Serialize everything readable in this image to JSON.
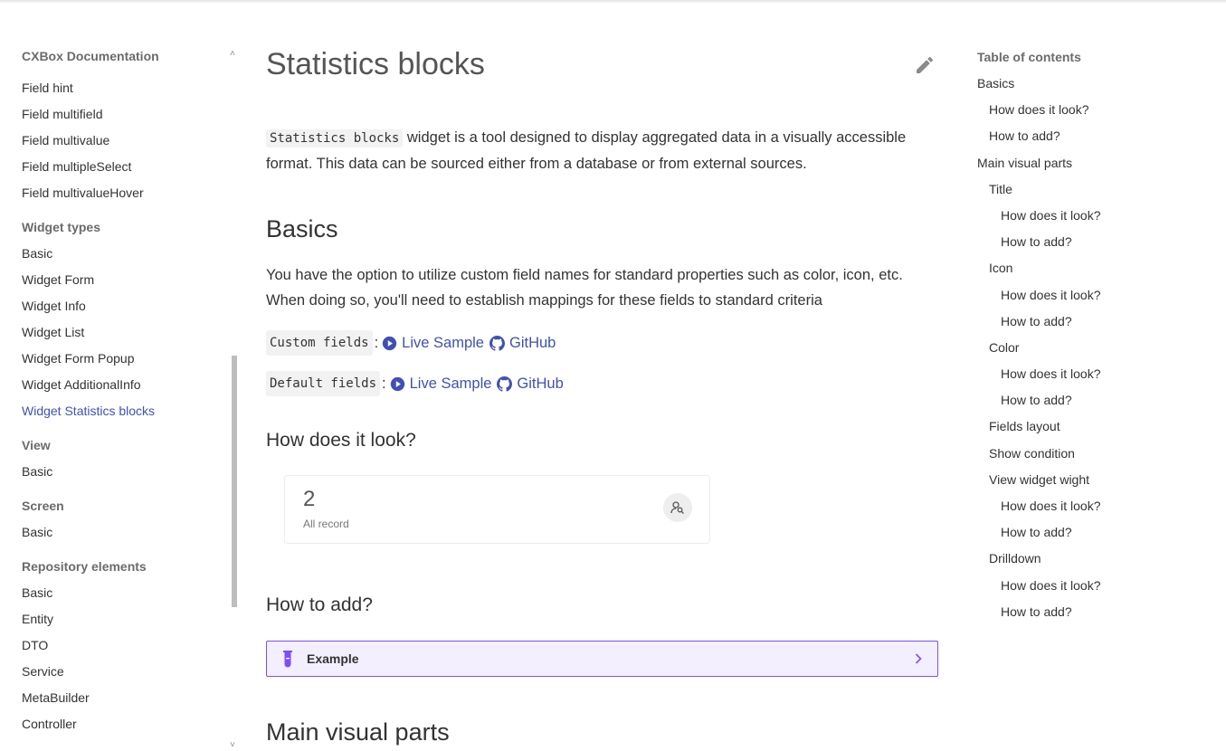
{
  "sidebar": {
    "title": "CXBox Documentation",
    "groups": [
      {
        "heading": "",
        "items": [
          "Field hint",
          "Field multifield",
          "Field multivalue",
          "Field multipleSelect",
          "Field multivalueHover"
        ]
      },
      {
        "heading": "Widget types",
        "items": [
          "Basic",
          "Widget Form",
          "Widget Info",
          "Widget List",
          "Widget Form Popup",
          "Widget AdditionalInfo",
          "Widget Statistics blocks"
        ]
      },
      {
        "heading": "View",
        "items": [
          "Basic"
        ]
      },
      {
        "heading": "Screen",
        "items": [
          "Basic"
        ]
      },
      {
        "heading": "Repository elements",
        "items": [
          "Basic",
          "Entity",
          "DTO",
          "Service",
          "MetaBuilder",
          "Controller"
        ]
      }
    ],
    "active_item": "Widget Statistics blocks"
  },
  "main": {
    "title": "Statistics blocks",
    "intro_code": "Statistics blocks",
    "intro_text": " widget is a tool designed to display aggregated data in a visually accessible format. This data can be sourced either from a database or from external sources.",
    "basics_heading": "Basics",
    "basics_text": "You have the option to utilize custom field names for standard properties such as color, icon, etc. When doing so, you'll need to establish mappings for these fields to standard criteria",
    "links": [
      {
        "code": "Custom fields",
        "sep": ":",
        "live_label": "Live Sample",
        "github_label": "GitHub"
      },
      {
        "code": "Default fields",
        "sep": ":",
        "live_label": "Live Sample",
        "github_label": "GitHub"
      }
    ],
    "look_heading": "How does it look?",
    "stat_card": {
      "value": "2",
      "label": "All record",
      "icon": "user-search-icon"
    },
    "add_heading": "How to add?",
    "example_label": "Example",
    "main_parts_heading": "Main visual parts"
  },
  "toc": {
    "title": "Table of contents",
    "items": [
      {
        "label": "Basics",
        "level": 1
      },
      {
        "label": "How does it look?",
        "level": 2
      },
      {
        "label": "How to add?",
        "level": 2
      },
      {
        "label": "Main visual parts",
        "level": 1
      },
      {
        "label": "Title",
        "level": 2
      },
      {
        "label": "How does it look?",
        "level": 3
      },
      {
        "label": "How to add?",
        "level": 3
      },
      {
        "label": "Icon",
        "level": 2
      },
      {
        "label": "How does it look?",
        "level": 3
      },
      {
        "label": "How to add?",
        "level": 3
      },
      {
        "label": "Color",
        "level": 2
      },
      {
        "label": "How does it look?",
        "level": 3
      },
      {
        "label": "How to add?",
        "level": 3
      },
      {
        "label": "Fields layout",
        "level": 2
      },
      {
        "label": "Show condition",
        "level": 2
      },
      {
        "label": "View widget wight",
        "level": 2
      },
      {
        "label": "How does it look?",
        "level": 3
      },
      {
        "label": "How to add?",
        "level": 3
      },
      {
        "label": "Drilldown",
        "level": 2
      },
      {
        "label": "How does it look?",
        "level": 3
      },
      {
        "label": "How to add?",
        "level": 3
      }
    ]
  },
  "colors": {
    "link": "#3f51b5",
    "example_border": "#7c4dff",
    "example_bg": "#f3efff"
  }
}
